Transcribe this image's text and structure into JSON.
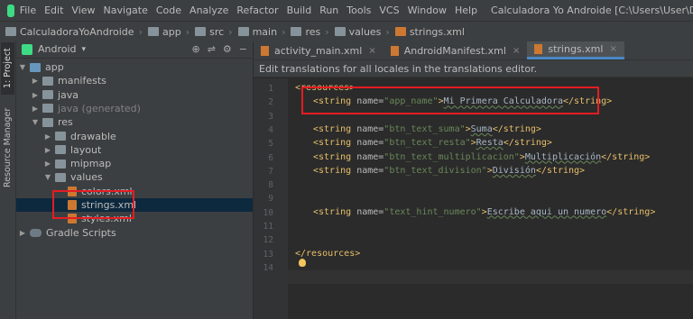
{
  "menubar": {
    "items": [
      "File",
      "Edit",
      "View",
      "Navigate",
      "Code",
      "Analyze",
      "Refactor",
      "Build",
      "Run",
      "Tools",
      "VCS",
      "Window",
      "Help"
    ],
    "window_title": "Calculadora Yo Androide [C:\\Users\\User\\Documents\\Repos\\CalculadoraYoA"
  },
  "breadcrumbs": [
    "CalculadoraYoAndroide",
    "app",
    "src",
    "main",
    "res",
    "values",
    "strings.xml"
  ],
  "toolstrip": {
    "project_tab": "1: Project",
    "resource_tab": "Resource Manager"
  },
  "project": {
    "view_mode": "Android",
    "tree": [
      {
        "label": "app",
        "level": 0,
        "expanded": true,
        "kind": "module"
      },
      {
        "label": "manifests",
        "level": 1,
        "expanded": false,
        "kind": "folder"
      },
      {
        "label": "java",
        "level": 1,
        "expanded": false,
        "kind": "folder"
      },
      {
        "label": "java (generated)",
        "level": 1,
        "expanded": false,
        "kind": "folder"
      },
      {
        "label": "res",
        "level": 1,
        "expanded": true,
        "kind": "folder"
      },
      {
        "label": "drawable",
        "level": 2,
        "expanded": false,
        "kind": "folder"
      },
      {
        "label": "layout",
        "level": 2,
        "expanded": false,
        "kind": "folder"
      },
      {
        "label": "mipmap",
        "level": 2,
        "expanded": false,
        "kind": "folder"
      },
      {
        "label": "values",
        "level": 2,
        "expanded": true,
        "kind": "folder"
      },
      {
        "label": "colors.xml",
        "level": 3,
        "kind": "xml"
      },
      {
        "label": "strings.xml",
        "level": 3,
        "kind": "xml",
        "selected": true
      },
      {
        "label": "styles.xml",
        "level": 3,
        "kind": "xml"
      },
      {
        "label": "Gradle Scripts",
        "level": 0,
        "expanded": false,
        "kind": "gradle"
      }
    ]
  },
  "editor": {
    "tabs": [
      {
        "label": "activity_main.xml",
        "active": false
      },
      {
        "label": "AndroidManifest.xml",
        "active": false
      },
      {
        "label": "strings.xml",
        "active": true
      }
    ],
    "banner": "Edit translations for all locales in the translations editor.",
    "lines": [
      {
        "n": "1",
        "text": "<resources>"
      },
      {
        "n": "2",
        "text": "<string name=\"app_name\">Mi Primera Calculadora</string>"
      },
      {
        "n": "3",
        "text": ""
      },
      {
        "n": "4",
        "text": "<string name=\"btn_text_suma\">Suma</string>"
      },
      {
        "n": "5",
        "text": "<string name=\"btn_text_resta\">Resta</string>"
      },
      {
        "n": "6",
        "text": "<string name=\"btn_text_multiplicacion\">Multiplicación</string>"
      },
      {
        "n": "7",
        "text": "<string name=\"btn_text_division\">División</string>"
      },
      {
        "n": "8",
        "text": ""
      },
      {
        "n": "9",
        "text": ""
      },
      {
        "n": "10",
        "text": "<string name=\"text_hint_numero\">Escribe aqui un numero</string>"
      },
      {
        "n": "11",
        "text": ""
      },
      {
        "n": "12",
        "text": ""
      },
      {
        "n": "13",
        "text": "</resources>"
      },
      {
        "n": "14",
        "text": ""
      }
    ]
  }
}
